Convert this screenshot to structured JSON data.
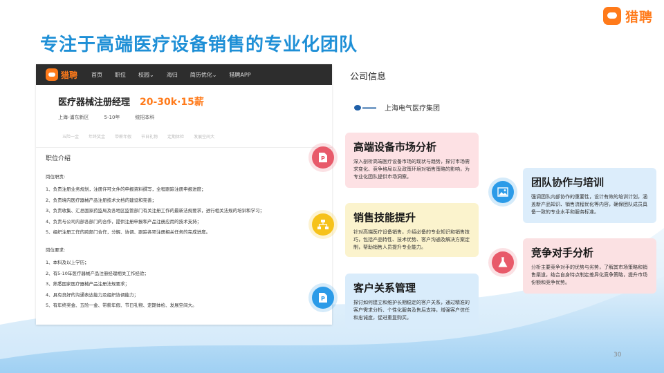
{
  "brand": {
    "name": "猎聘"
  },
  "slide": {
    "title": "专注于高端医疗设备销售的专业化团队",
    "page_number": "30"
  },
  "job": {
    "nav": {
      "logo_text": "猎聘",
      "items": [
        "首页",
        "职位",
        "校园⌄",
        "海归",
        "简历优化⌄",
        "猎聘APP"
      ]
    },
    "title": "医疗器械注册经理",
    "salary": "20-30k·15薪",
    "meta": [
      "上海-浦东新区",
      "5-10年",
      "统招本科"
    ],
    "tags": [
      "五险一金",
      "年终奖金",
      "带薪年假",
      "节日礼物",
      "定期体检",
      "发展空间大"
    ],
    "section_title": "职位介绍",
    "duties_heading": "岗位职责:",
    "duties": [
      "1、负责注册业务规划，注册许可文件的申报资料撰写，全程跟踪注册申报进度；",
      "2、负责境内医疗器械产品注册技术文档的建设和完善；",
      "3、负责收集、汇总国家药监局及各地区监管部门有关注册工作的最新法规要求，进行相关法规的培训和学习；",
      "4、负责与公司内部各部门的合作，提供注册申报和产品注册应用的技术支持；",
      "5、组织注册工作的跨部门合作，分解、协调、跟踪各项注册相关任务的完成进度。"
    ],
    "requirements_heading": "岗位要求:",
    "requirements": [
      "1、本科及以上学历；",
      "2、有5-10年医疗器械产品注册经理相关工作经验；",
      "3、熟悉国家医疗器械产品注册法规要求；",
      "4、具有良好的沟通表达能力及组织协调能力；",
      "5、有年终奖金、五险一金、带薪年假、节日礼物、定期体检、发展空间大。"
    ]
  },
  "company": {
    "label": "公司信息",
    "logo_text": "上海电气",
    "name": "上海电气医疗集团"
  },
  "cards": [
    {
      "icon": "ppt-icon",
      "title": "高端设备市场分析",
      "body": "深入剖析高端医疗设备市场的现状与趋势，探讨市场需求变化、竞争格局以及政策环境对销售策略的影响，为专业化团队提供市场洞察。"
    },
    {
      "icon": "network-icon",
      "title": "销售技能提升",
      "body": "针对高端医疗设备销售，介绍必备的专业知识和销售技巧，包括产品特性、技术优势、客户沟通及解决方案定制，帮助销售人员提升专业能力。"
    },
    {
      "icon": "ppt-icon",
      "title": "客户关系管理",
      "body": "探讨如何建立和维护长期稳定的客户关系，通过精准的客户需求分析、个性化服务及售后支持，增强客户信任和忠诚度，促进重复购买。"
    },
    {
      "icon": "image-icon",
      "title": "团队协作与培训",
      "body": "强调团队内部协作的重要性，设计有效的培训计划，涵盖新产品知识、销售流程优化等内容，确保团队成员具备一致的专业水平和服务标准。"
    },
    {
      "icon": "flask-icon",
      "title": "竞争对手分析",
      "body": "分析主要竞争对手的优势与劣势，了解其市场策略和销售渠道，结合自身特点制定差异化竞争策略，提升市场份额和竞争优势。"
    }
  ],
  "colors": {
    "title_blue": "#1e8fd6",
    "brand_orange": "#ff7a1a",
    "pink": "#e85a6a",
    "yellow": "#f6c21b",
    "blue": "#2b9be8"
  }
}
